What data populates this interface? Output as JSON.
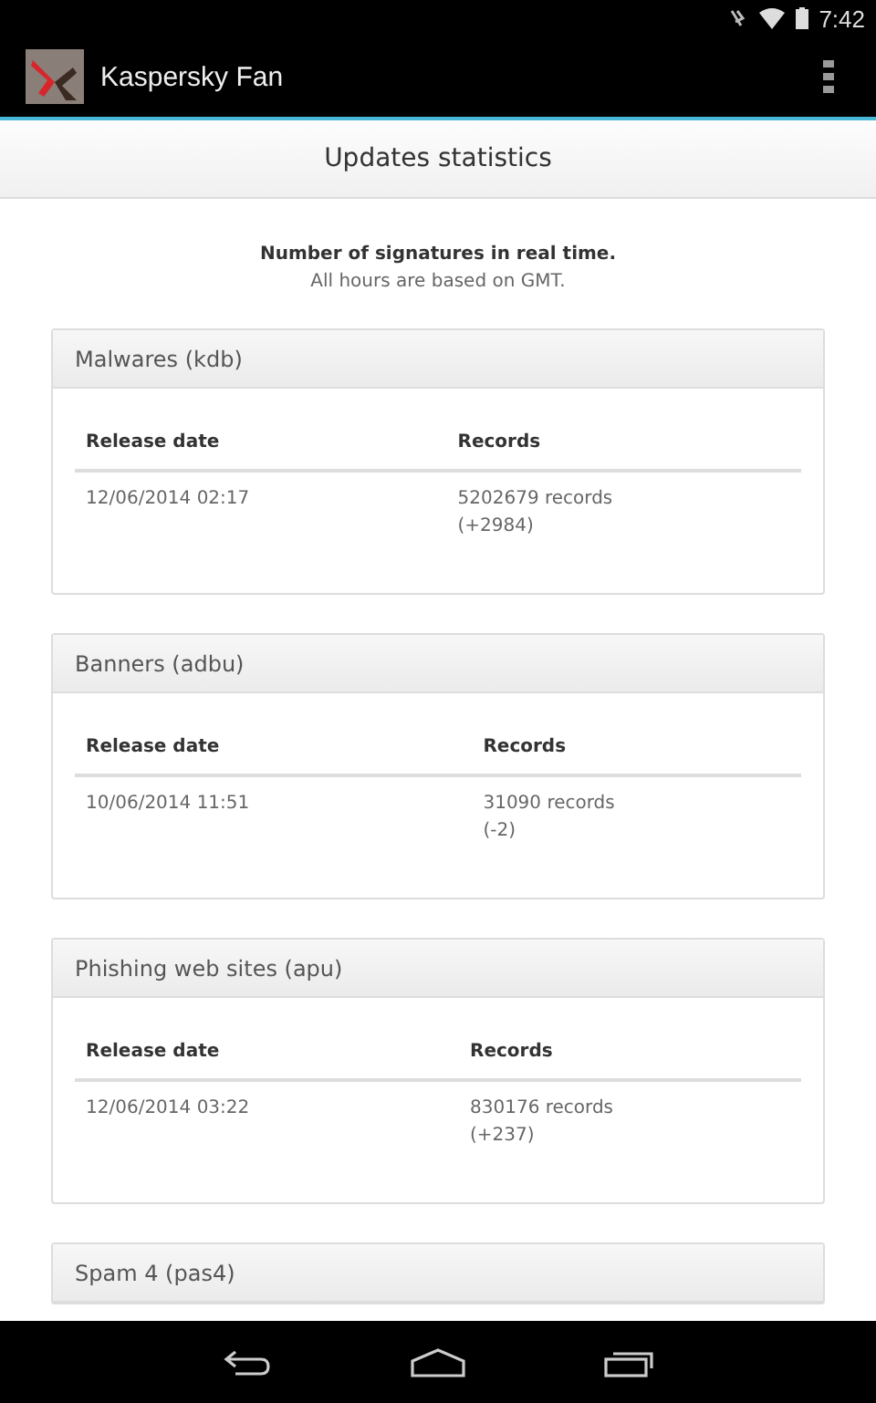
{
  "status_bar": {
    "time": "7:42"
  },
  "app_bar": {
    "title": "Kaspersky Fan"
  },
  "page_header": {
    "title": "Updates statistics"
  },
  "intro": {
    "heading": "Number of signatures in real time.",
    "note": "All hours are based on GMT."
  },
  "cards": [
    {
      "title": "Malwares (kdb)",
      "columns": [
        "Release date",
        "Records"
      ],
      "rows": [
        {
          "date": "12/06/2014 02:17",
          "records": "5202679 records",
          "change": "(+2984)"
        }
      ]
    },
    {
      "title": "Banners (adbu)",
      "columns": [
        "Release date",
        "Records"
      ],
      "rows": [
        {
          "date": "10/06/2014 11:51",
          "records": "31090 records",
          "change": "(-2)"
        }
      ]
    },
    {
      "title": "Phishing web sites (apu)",
      "columns": [
        "Release date",
        "Records"
      ],
      "rows": [
        {
          "date": "12/06/2014 03:22",
          "records": "830176 records",
          "change": "(+237)"
        }
      ]
    },
    {
      "title": "Spam 4 (pas4)"
    }
  ]
}
